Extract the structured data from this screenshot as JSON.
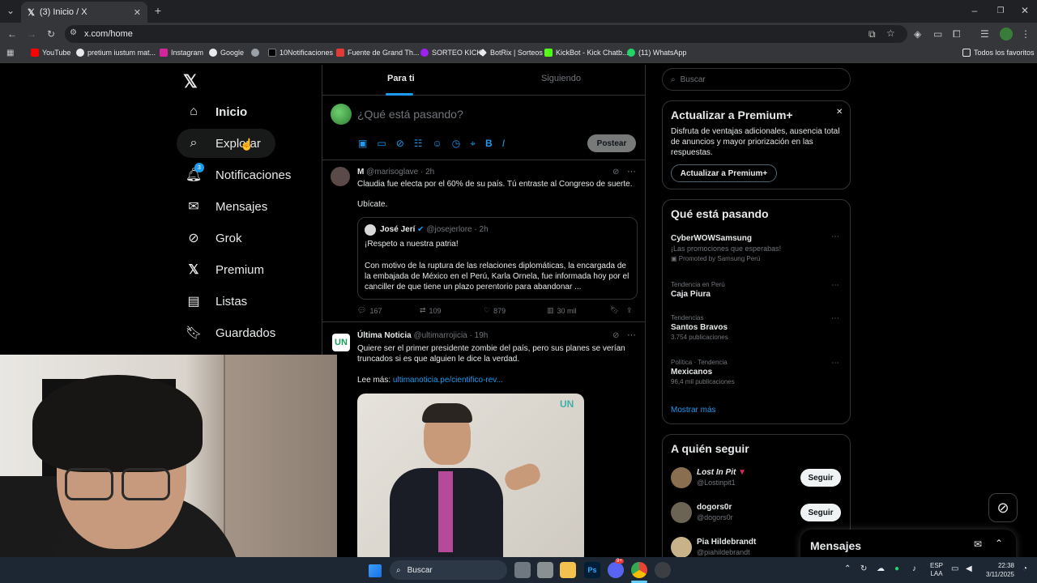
{
  "browser": {
    "tab_title": "(3) Inicio / X",
    "url": "x.com/home",
    "bookmarks": [
      "YouTube",
      "pretium iustum mat...",
      "Instagram",
      "Google",
      "",
      "10Notificaciones",
      "Fuente de Grand Th...",
      "SORTEO KICK",
      "BotRix | Sorteos",
      "KickBot - Kick Chatb...",
      "(11) WhatsApp"
    ],
    "all_bookmarks": "Todos los favoritos"
  },
  "nav": {
    "items": [
      "Inicio",
      "Explorar",
      "Notificaciones",
      "Mensajes",
      "Grok",
      "Premium",
      "Listas",
      "Guardados"
    ],
    "notif_badge": "3"
  },
  "feed": {
    "tabs": [
      "Para ti",
      "Siguiendo"
    ],
    "compose_placeholder": "¿Qué está pasando?",
    "post_button": "Postear",
    "posts": [
      {
        "name": "M",
        "handle": "@marisoglave",
        "time": "· 2h",
        "text1": "Claudia fue electa por el 60% de su país. Tú entraste al Congreso de suerte.",
        "text2": "Ubícate.",
        "quote": {
          "name": "José Jerí",
          "handle": "@josejerlore",
          "time": "· 2h",
          "text1": "¡Respeto a nuestra patria!",
          "text2": "Con motivo de la ruptura de las relaciones diplomáticas, la encargada de la embajada de México en el Perú, Karla Ornela, fue informada hoy por el canciller de que tiene un plazo perentorio para abandonar ..."
        },
        "replies": "167",
        "reposts": "109",
        "likes": "879",
        "views": "30 mil"
      },
      {
        "name": "Última Noticia",
        "handle": "@ultimarrojicia",
        "time": "· 19h",
        "text1": "Quiere ser el primer presidente zombie del país, pero sus planes se verían truncados si es que alguien le dice la verdad.",
        "text2_prefix": "Lee más:",
        "link": "ultimanoticia.pe/cientifico-rev...",
        "image_logo": "UN"
      }
    ]
  },
  "sidebar": {
    "search_placeholder": "Buscar",
    "premium": {
      "title": "Actualizar a Premium+",
      "text": "Disfruta de ventajas adicionales, ausencia total de anuncios y mayor priorización en las respuestas.",
      "button": "Actualizar a Premium+"
    },
    "trends": {
      "title": "Qué está pasando",
      "items": [
        {
          "name": "CyberWOWSamsung",
          "sub": "¡Las promociones que esperabas!",
          "promo": "Promoted by Samsung Perú"
        },
        {
          "cat": "Tendencia en Perú",
          "name": "Caja Piura"
        },
        {
          "cat": "Tendencias",
          "name": "Santos Bravos",
          "count": "3.754 publicaciones"
        },
        {
          "cat": "Política · Tendencia",
          "name": "Mexicanos",
          "count": "96,4 mil publicaciones"
        }
      ],
      "show_more": "Mostrar más"
    },
    "follow": {
      "title": "A quién seguir",
      "items": [
        {
          "name": "Lost In Pit",
          "handle": "@Lostinpit1"
        },
        {
          "name": "dogors0r",
          "handle": "@dogors0r"
        },
        {
          "name": "Pia Hildebrandt",
          "handle": "@piahildebrandt"
        }
      ],
      "button": "Seguir"
    },
    "messages_label": "Mensajes"
  },
  "taskbar": {
    "search_placeholder": "Buscar",
    "lang_top": "ESP",
    "lang_bottom": "LAA",
    "time": "22:38",
    "date": "3/11/2025",
    "discord_badge": "9+"
  },
  "colors": {
    "accent": "#1d9bf0",
    "bg": "#000000",
    "border": "#2f3336"
  }
}
